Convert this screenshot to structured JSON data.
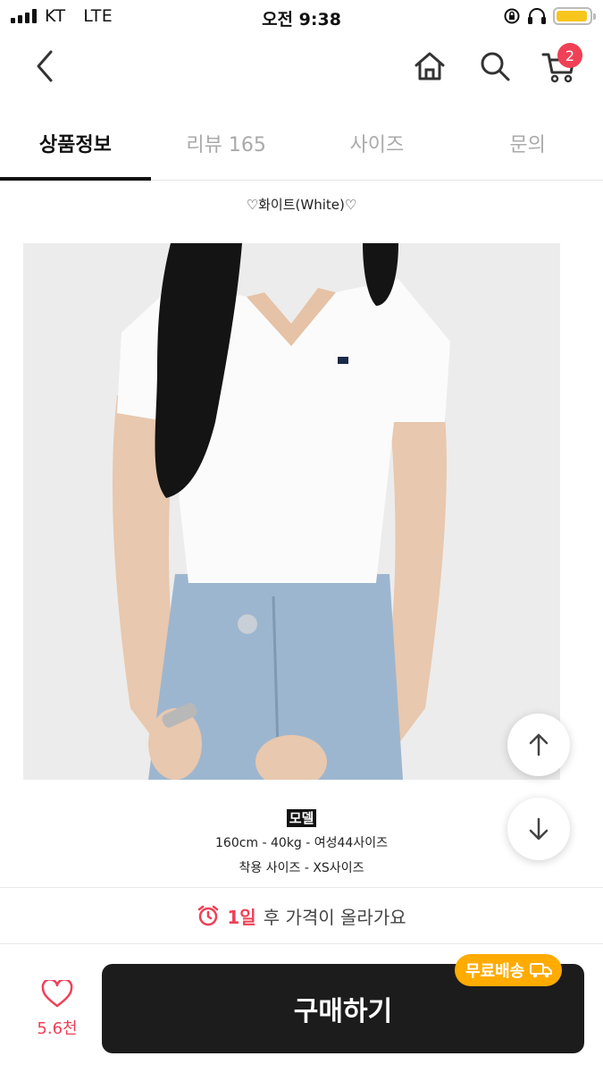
{
  "status_bar": {
    "carrier": "KT",
    "network": "LTE",
    "time": "오전 9:38",
    "battery_level": 0.95,
    "battery_color": "#f7c51c"
  },
  "nav": {
    "back_icon": "back-arrow-icon",
    "home_icon": "home-icon",
    "search_icon": "search-icon",
    "cart_icon": "cart-icon",
    "cart_count": "2"
  },
  "tabs": [
    {
      "label": "상품정보",
      "active": true
    },
    {
      "label": "리뷰 165",
      "active": false
    },
    {
      "label": "사이즈",
      "active": false
    },
    {
      "label": "문의",
      "active": false
    }
  ],
  "content": {
    "color_label": "♡화이트(White)♡",
    "model_title": "모델",
    "model_stats": "160cm - 40kg - 여성44사이즈",
    "model_size": "착용 사이즈 - XS사이즈"
  },
  "floating": {
    "up_icon": "arrow-up-icon",
    "down_icon": "arrow-down-icon"
  },
  "notice": {
    "days": "1일",
    "text": "후 가격이 올라가요",
    "icon": "alarm-clock-icon"
  },
  "bottom": {
    "like_icon": "heart-icon",
    "like_count": "5.6천",
    "buy_label": "구매하기",
    "free_shipping": "무료배송",
    "truck_icon": "truck-icon"
  },
  "colors": {
    "accent": "#ef4056",
    "buy_button": "#1c1c1c",
    "badge": "#ffab00"
  }
}
